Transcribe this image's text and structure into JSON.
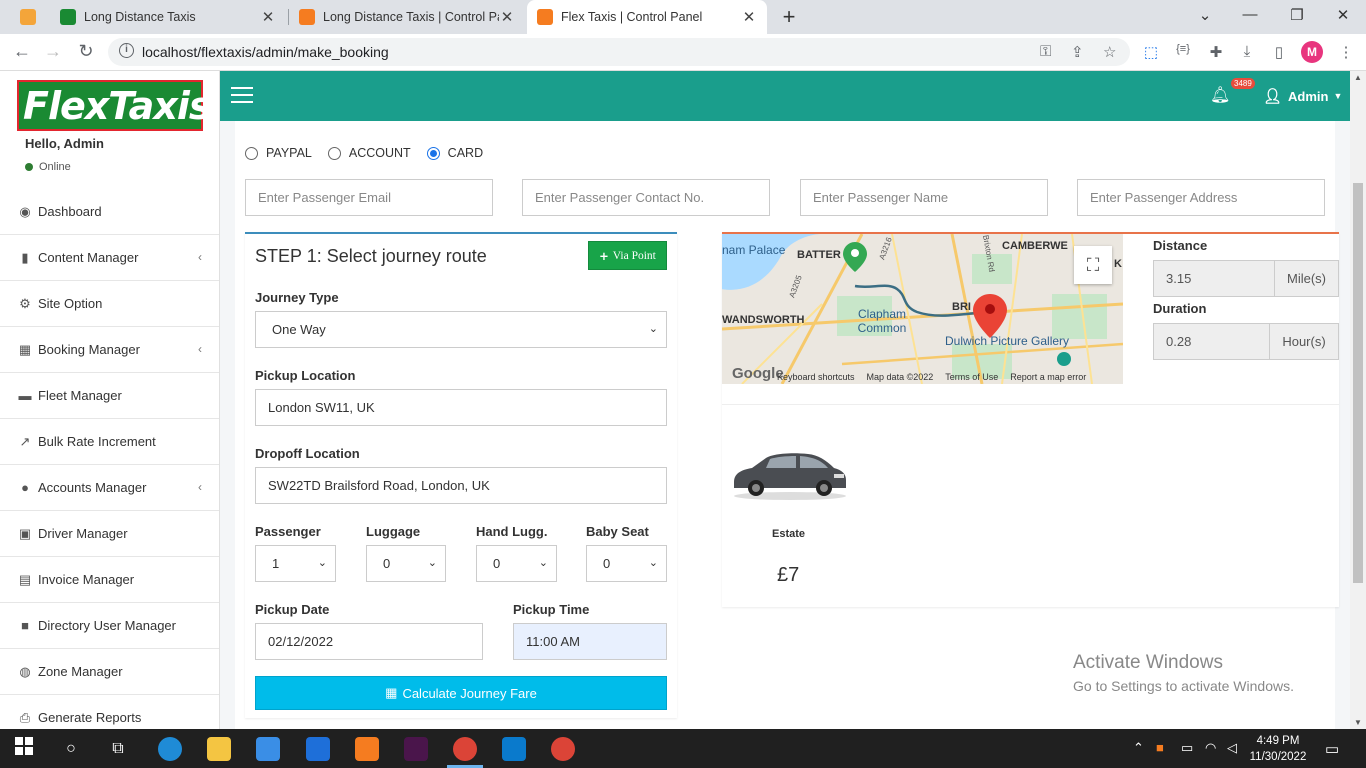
{
  "browser": {
    "tabs": [
      {
        "title": "Long Distance Taxis",
        "active": false,
        "favicon_color": "#1a8a33"
      },
      {
        "title": "Long Distance Taxis | Control Pan",
        "active": false,
        "favicon_color": "#f57c20"
      },
      {
        "title": "Flex Taxis | Control Panel",
        "active": true,
        "favicon_color": "#f57c20"
      }
    ],
    "close_glyph": "✕",
    "new_tab_glyph": "+",
    "url": "localhost/flextaxis/admin/make_booking",
    "profile_initial": "M"
  },
  "app": {
    "logo_text": "FlexTaxis",
    "user_greeting": "Hello, Admin",
    "user_status": "Online",
    "admin_label": "Admin",
    "notification_count": "3489",
    "colors": {
      "topbar": "#1a9e8c",
      "logo_bg": "#1a8a33",
      "logo_border": "#e3262f",
      "calc_button": "#00bcea",
      "via_button": "#18a449"
    }
  },
  "sidebar": {
    "items": [
      {
        "label": "Dashboard",
        "icon": "palette-icon",
        "glyph": "🎨",
        "submenu": false
      },
      {
        "label": "Content Manager",
        "icon": "file-icon",
        "glyph": "📄",
        "submenu": true
      },
      {
        "label": "Site Option",
        "icon": "cogs-icon",
        "glyph": "⚙",
        "submenu": false
      },
      {
        "label": "Booking Manager",
        "icon": "calendar-icon",
        "glyph": "▦",
        "submenu": true
      },
      {
        "label": "Fleet Manager",
        "icon": "car-icon",
        "glyph": "🚘",
        "submenu": false
      },
      {
        "label": "Bulk Rate Increment",
        "icon": "chart-line-icon",
        "glyph": "📈",
        "submenu": false
      },
      {
        "label": "Accounts Manager",
        "icon": "users-icon",
        "glyph": "👥",
        "submenu": true
      },
      {
        "label": "Driver Manager",
        "icon": "lock-icon",
        "glyph": "🔒",
        "submenu": false
      },
      {
        "label": "Invoice Manager",
        "icon": "file-excel-icon",
        "glyph": "🗎",
        "submenu": false
      },
      {
        "label": "Directory User Manager",
        "icon": "folder-icon",
        "glyph": "📁",
        "submenu": false
      },
      {
        "label": "Zone Manager",
        "icon": "globe-icon",
        "glyph": "🌐",
        "submenu": false
      },
      {
        "label": "Generate Reports",
        "icon": "print-icon",
        "glyph": "🖶",
        "submenu": false
      }
    ]
  },
  "booking": {
    "payment_methods": [
      {
        "label": "PAYPAL",
        "checked": false
      },
      {
        "label": "ACCOUNT",
        "checked": false
      },
      {
        "label": "CARD",
        "checked": true
      }
    ],
    "passenger_fields": [
      {
        "placeholder": "Enter Passenger Email"
      },
      {
        "placeholder": "Enter Passenger Contact No."
      },
      {
        "placeholder": "Enter Passenger Name"
      },
      {
        "placeholder": "Enter Passenger Address"
      }
    ],
    "step_title": "STEP 1: Select journey route",
    "via_point_label": "Via Point",
    "journey_type_label": "Journey Type",
    "journey_type_value": "One Way",
    "pickup_label": "Pickup Location",
    "pickup_value": "London SW11, UK",
    "dropoff_label": "Dropoff Location",
    "dropoff_value": "SW22TD Brailsford Road, London, UK",
    "counts": [
      {
        "label": "Passenger",
        "value": "1"
      },
      {
        "label": "Luggage",
        "value": "0"
      },
      {
        "label": "Hand Lugg.",
        "value": "0"
      },
      {
        "label": "Baby Seat",
        "value": "0"
      }
    ],
    "pickup_date_label": "Pickup Date",
    "pickup_date_value": "02/12/2022",
    "pickup_time_label": "Pickup Time",
    "pickup_time_value": "11:00 AM",
    "calculate_label": "Calculate Journey Fare"
  },
  "route": {
    "distance_label": "Distance",
    "distance_value": "3.15",
    "distance_unit": "Mile(s)",
    "duration_label": "Duration",
    "duration_value": "0.28",
    "duration_unit": "Hour(s)",
    "map_labels": [
      "nam Palace",
      "BATTER",
      "CAMBERWE",
      "K",
      "WANDSWORTH",
      "Clapham Common",
      "BRI",
      "Dulwich Picture Gallery",
      "A3205",
      "A3216",
      "Brixton Rd"
    ],
    "map_footer": [
      "Google",
      "Keyboard shortcuts",
      "Map data ©2022",
      "Terms of Use",
      "Report a map error"
    ]
  },
  "vehicle": {
    "name": "Estate",
    "price": "£7"
  },
  "watermark": {
    "line1": "Activate Windows",
    "line2": "Go to Settings to activate Windows."
  },
  "taskbar": {
    "time": "4:49 PM",
    "date": "11/30/2022"
  }
}
